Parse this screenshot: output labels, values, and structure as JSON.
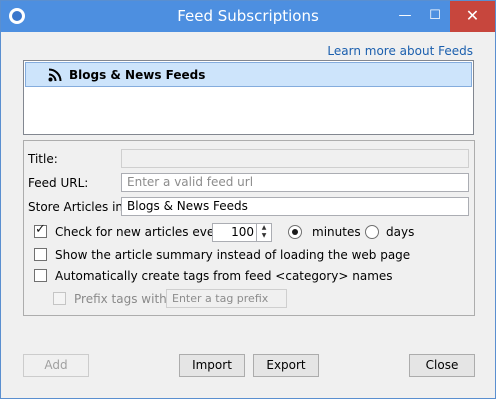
{
  "window": {
    "title": "Feed Subscriptions",
    "minimize": "—",
    "maximize": "☐",
    "close": "✕"
  },
  "learn_more": "Learn more about Feeds",
  "feeds": [
    {
      "label": "Blogs & News Feeds",
      "icon": "rss-icon"
    }
  ],
  "form": {
    "title_label": "Title:",
    "title_value": "",
    "feed_url_label": "Feed URL:",
    "feed_url_placeholder": "Enter a valid feed url",
    "store_label": "Store Articles in:",
    "store_value": "Blogs & News Feeds",
    "check_label": "Check for new articles every",
    "check_checked": true,
    "interval_value": "100",
    "unit_minutes": "minutes",
    "unit_days": "days",
    "selected_unit": "minutes",
    "summary_label": "Show the article summary instead of loading the web page",
    "summary_checked": false,
    "autotag_label": "Automatically create tags from feed <category> names",
    "autotag_checked": false,
    "prefix_label": "Prefix tags with:",
    "prefix_placeholder": "Enter a tag prefix",
    "prefix_enabled": false
  },
  "buttons": {
    "add": "Add",
    "import": "Import",
    "export": "Export",
    "close": "Close"
  },
  "colors": {
    "titlebar": "#4d8fe0",
    "close_button": "#c7463d",
    "link": "#1b5fae",
    "selection": "#cde4fb"
  }
}
